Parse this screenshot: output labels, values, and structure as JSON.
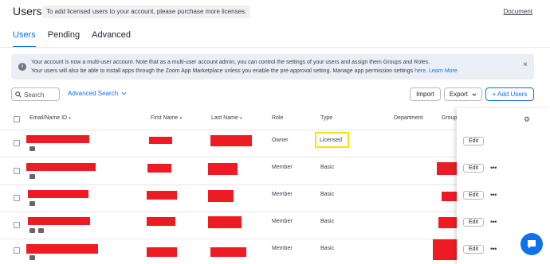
{
  "header": {
    "title": "Users",
    "notice": "To add licensed users to your account, please purchase more licenses.",
    "doc_link": "Document"
  },
  "tabs": [
    {
      "label": "Users",
      "active": true
    },
    {
      "label": "Pending",
      "active": false
    },
    {
      "label": "Advanced",
      "active": false
    }
  ],
  "banner": {
    "line1": "Your account is now a multi-user account. Note that as a multi-user account admin, you can control the settings of your users and assign them Groups and Roles.",
    "line2_prefix": "Your users will also be able to install apps through the Zoom App Marketplace unless you enable the pre-approval setting. Manage app permission settings ",
    "line2_link1": "here",
    "line2_dot": ". ",
    "line2_link2": "Learn More",
    "close": "×"
  },
  "toolbar": {
    "search_placeholder": "Search",
    "advanced_search": "Advanced Search",
    "import": "Import",
    "export": "Export",
    "add_users": "+ Add Users"
  },
  "table": {
    "columns": {
      "email": "Email/Name ID",
      "first_name": "First Name",
      "last_name": "Last Name",
      "role": "Role",
      "type": "Type",
      "department": "Department",
      "group": "Group"
    },
    "sort_glyph": "♦",
    "edit_label": "Edit",
    "more_label": "•••",
    "rows": [
      {
        "role": "Owner",
        "type": "Licensed",
        "highlighted": true
      },
      {
        "role": "Member",
        "type": "Basic",
        "highlighted": false
      },
      {
        "role": "Member",
        "type": "Basic",
        "highlighted": false
      },
      {
        "role": "Member",
        "type": "Basic",
        "highlighted": false
      },
      {
        "role": "Member",
        "type": "Basic",
        "highlighted": false
      }
    ]
  },
  "icons": {
    "search": "search-icon",
    "chevron": "chevron-down-icon",
    "info": "info-icon",
    "close": "close-icon",
    "gear": "gear-icon",
    "chat": "chat-icon"
  },
  "colors": {
    "accent": "#0e72ed",
    "redaction": "#ed1c24",
    "highlight": "#f5e20a"
  }
}
